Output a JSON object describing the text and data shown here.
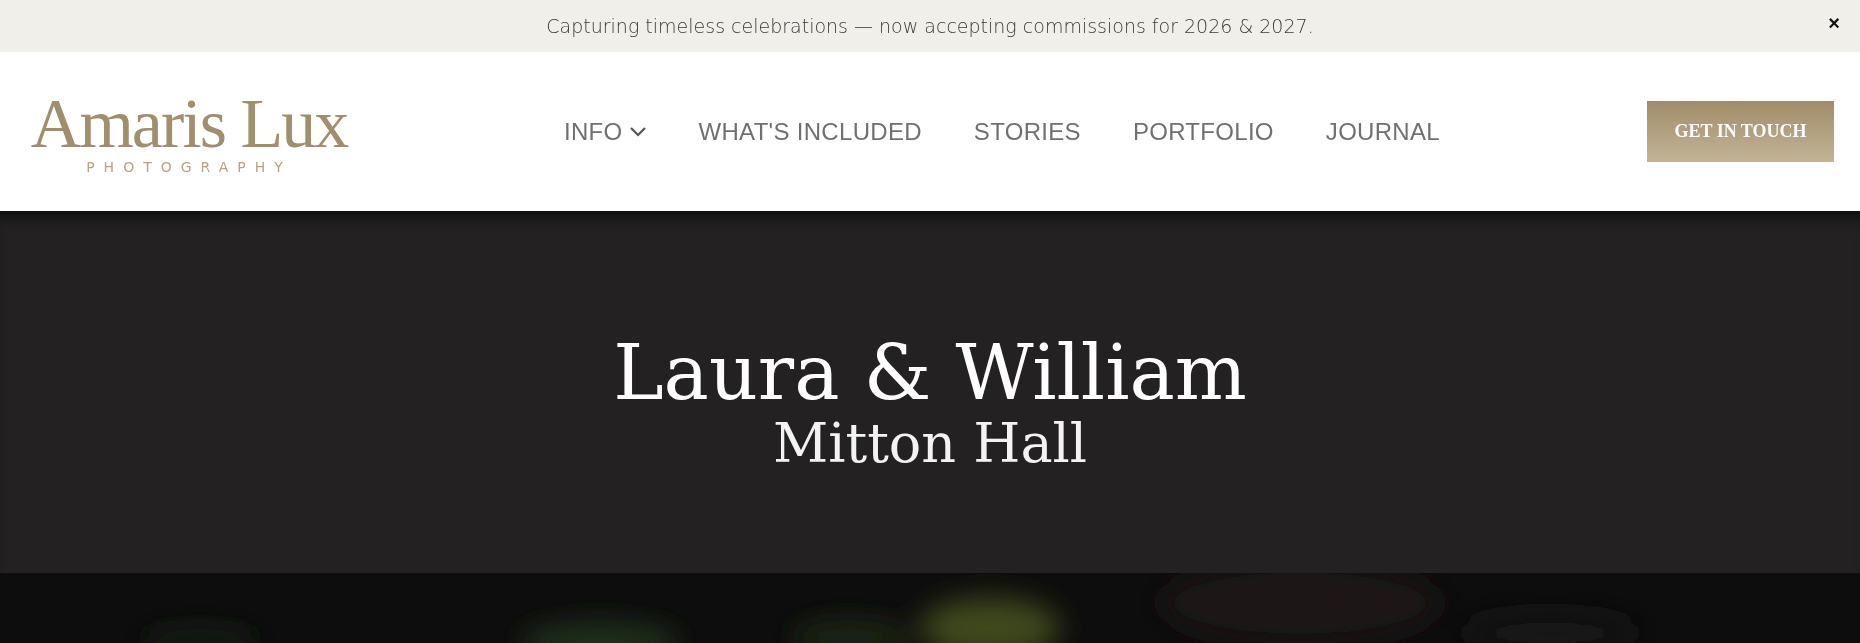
{
  "announcement": {
    "text": "Capturing timeless celebrations — now accepting commissions for 2026 & 2027.",
    "close": "×"
  },
  "logo": {
    "name": "Amaris Lux",
    "tagline": "PHOTOGRAPHY"
  },
  "nav": [
    {
      "label": "INFO",
      "kind": "dropdown"
    },
    {
      "label": "WHAT'S INCLUDED",
      "kind": "link"
    },
    {
      "label": "STORIES",
      "kind": "link"
    },
    {
      "label": "PORTFOLIO",
      "kind": "link"
    },
    {
      "label": "JOURNAL",
      "kind": "link"
    }
  ],
  "cta": "GET IN TOUCH",
  "hero": {
    "title": "Laura & William",
    "subtitle": "Mitton Hall"
  }
}
